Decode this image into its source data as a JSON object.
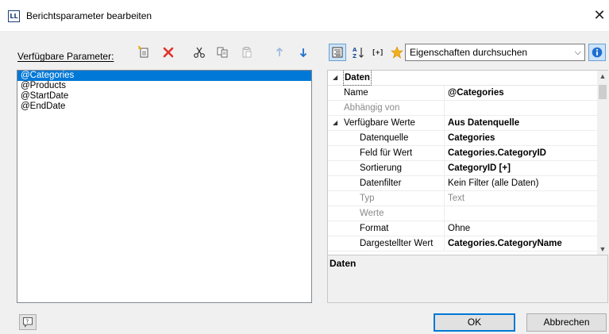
{
  "window": {
    "app_icon_text": "LL",
    "title": "Berichtsparameter bearbeiten",
    "close": "✕"
  },
  "left": {
    "label": "Verfügbare Parameter:",
    "params": [
      "@Categories",
      "@Products",
      "@StartDate",
      "@EndDate"
    ],
    "selected_index": 0
  },
  "right": {
    "search_placeholder": "Eigenschaften durchsuchen",
    "category": "Daten",
    "rows": {
      "name": {
        "label": "Name",
        "value": "@Categories"
      },
      "abhaengig": {
        "label": "Abhängig von",
        "value": ""
      },
      "werte": {
        "label": "Verfügbare Werte",
        "value": "Aus Datenquelle"
      },
      "datenquelle": {
        "label": "Datenquelle",
        "value": "Categories"
      },
      "feld": {
        "label": "Feld für Wert",
        "value": "Categories.CategoryID"
      },
      "sortierung": {
        "label": "Sortierung",
        "value": "CategoryID [+]"
      },
      "datenfilter": {
        "label": "Datenfilter",
        "value": "Kein Filter (alle Daten)"
      },
      "typ": {
        "label": "Typ",
        "value": "Text"
      },
      "werte2": {
        "label": "Werte",
        "value": ""
      },
      "format": {
        "label": "Format",
        "value": "Ohne"
      },
      "dargestellt": {
        "label": "Dargestellter Wert",
        "value": "Categories.CategoryName"
      }
    },
    "description_title": "Daten"
  },
  "buttons": {
    "ok": "OK",
    "cancel": "Abbrechen",
    "help": "?"
  },
  "colors": {
    "selection": "#0078d7",
    "delete_red": "#e0312b",
    "arrow_blue": "#1f6fd1",
    "star": "#f2b11a"
  }
}
